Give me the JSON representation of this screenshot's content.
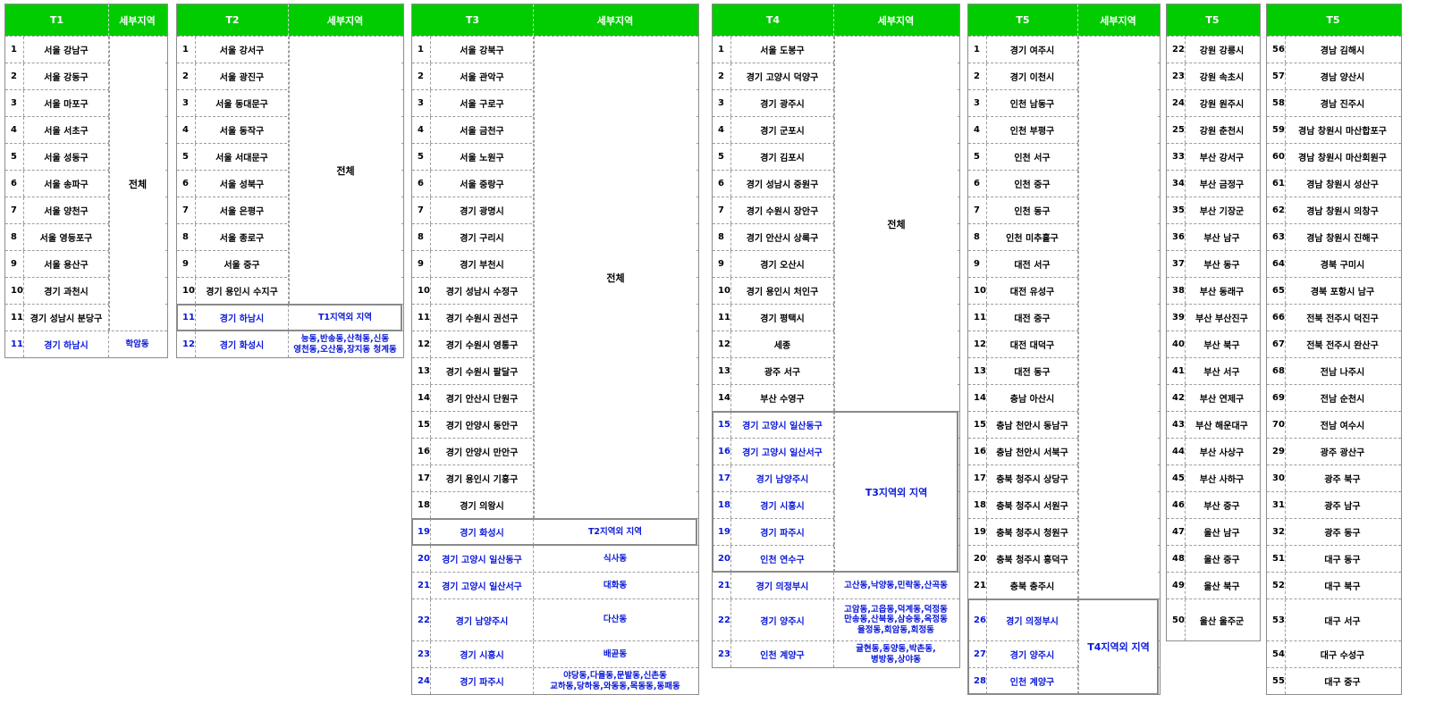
{
  "t1": {
    "header": [
      "T1",
      "세부지역"
    ],
    "rows": [
      {
        "n": "1",
        "r": "서울 강남구"
      },
      {
        "n": "2",
        "r": "서울 강동구"
      },
      {
        "n": "3",
        "r": "서울 마포구"
      },
      {
        "n": "4",
        "r": "서울 서초구"
      },
      {
        "n": "5",
        "r": "서울 성동구"
      },
      {
        "n": "6",
        "r": "서울 송파구"
      },
      {
        "n": "7",
        "r": "서울 양천구"
      },
      {
        "n": "8",
        "r": "서울 영등포구"
      },
      {
        "n": "9",
        "r": "서울 용산구"
      },
      {
        "n": "10",
        "r": "경기 과천시"
      },
      {
        "n": "11",
        "r": "경기 성남시 분당구"
      },
      {
        "n": "11",
        "r": "경기 하남시",
        "s": "학암동",
        "blue": true
      }
    ],
    "merged": "전체"
  },
  "t2": {
    "header": [
      "T2",
      "세부지역"
    ],
    "rows": [
      {
        "n": "1",
        "r": "서울 강서구"
      },
      {
        "n": "2",
        "r": "서울 광진구"
      },
      {
        "n": "3",
        "r": "서울 동대문구"
      },
      {
        "n": "4",
        "r": "서울 동작구"
      },
      {
        "n": "5",
        "r": "서울 서대문구"
      },
      {
        "n": "6",
        "r": "서울 성북구"
      },
      {
        "n": "7",
        "r": "서울 은평구"
      },
      {
        "n": "8",
        "r": "서울 종로구"
      },
      {
        "n": "9",
        "r": "서울 중구"
      },
      {
        "n": "10",
        "r": "경기 용인시 수지구"
      },
      {
        "n": "11",
        "r": "경기 하남시",
        "s": "T1지역외 지역",
        "blue": true
      },
      {
        "n": "12",
        "r": "경기 화성시",
        "s": "능동,반송동,산척동,신동\n영천동,오산동,장지동 청계동",
        "blue": true
      }
    ],
    "merged": "전체"
  },
  "t3": {
    "header": [
      "T3",
      "세부지역"
    ],
    "rows": [
      {
        "n": "1",
        "r": "서울 강북구"
      },
      {
        "n": "2",
        "r": "서울 관악구"
      },
      {
        "n": "3",
        "r": "서울 구로구"
      },
      {
        "n": "4",
        "r": "서울 금천구"
      },
      {
        "n": "5",
        "r": "서울 노원구"
      },
      {
        "n": "6",
        "r": "서울 중랑구"
      },
      {
        "n": "7",
        "r": "경기 광명시"
      },
      {
        "n": "8",
        "r": "경기 구리시"
      },
      {
        "n": "9",
        "r": "경기 부천시"
      },
      {
        "n": "10",
        "r": "경기 성남시 수정구"
      },
      {
        "n": "11",
        "r": "경기 수원시 권선구"
      },
      {
        "n": "12",
        "r": "경기 수원시 영통구"
      },
      {
        "n": "13",
        "r": "경기 수원시 팔달구"
      },
      {
        "n": "14",
        "r": "경기 안산시 단원구"
      },
      {
        "n": "15",
        "r": "경기 안양시 동안구"
      },
      {
        "n": "16",
        "r": "경기 안양시 만안구"
      },
      {
        "n": "17",
        "r": "경기 용인시 기흥구"
      },
      {
        "n": "18",
        "r": "경기 의왕시"
      },
      {
        "n": "19",
        "r": "경기 화성시",
        "s": "T2지역외 지역",
        "blue": true
      },
      {
        "n": "20",
        "r": "경기 고양시 일산동구",
        "s": "식사동",
        "blue": true
      },
      {
        "n": "21",
        "r": "경기 고양시 일산서구",
        "s": "대화동",
        "blue": true
      },
      {
        "n": "22",
        "r": "경기 남양주시",
        "s": "다산동",
        "blue": true
      },
      {
        "n": "23",
        "r": "경기 시흥시",
        "s": "배곧동",
        "blue": true
      },
      {
        "n": "24",
        "r": "경기 파주시",
        "s": "야당동,다율동,문발동,신촌동\n교하동,당하동,와동동,목동동,동패동",
        "blue": true
      }
    ],
    "merged": "전체"
  },
  "t4": {
    "header": [
      "T4",
      "세부지역"
    ],
    "rows": [
      {
        "n": "1",
        "r": "서울 도봉구"
      },
      {
        "n": "2",
        "r": "경기 고양시 덕양구"
      },
      {
        "n": "3",
        "r": "경기 광주시"
      },
      {
        "n": "4",
        "r": "경기 군포시"
      },
      {
        "n": "5",
        "r": "경기 김포시"
      },
      {
        "n": "6",
        "r": "경기 성남시 중원구"
      },
      {
        "n": "7",
        "r": "경기 수원시 장안구"
      },
      {
        "n": "8",
        "r": "경기 안산시 상록구"
      },
      {
        "n": "9",
        "r": "경기 오산시"
      },
      {
        "n": "10",
        "r": "경기 용인시 처인구"
      },
      {
        "n": "11",
        "r": "경기 평택시"
      },
      {
        "n": "12",
        "r": "세종"
      },
      {
        "n": "13",
        "r": "광주 서구"
      },
      {
        "n": "14",
        "r": "부산 수영구"
      },
      {
        "n": "15",
        "r": "경기 고양시 일산동구",
        "blue": true
      },
      {
        "n": "16",
        "r": "경기 고양시 일산서구",
        "blue": true
      },
      {
        "n": "17",
        "r": "경기 남양주시",
        "blue": true
      },
      {
        "n": "18",
        "r": "경기 시흥시",
        "blue": true
      },
      {
        "n": "19",
        "r": "경기 파주시",
        "blue": true
      },
      {
        "n": "20",
        "r": "인천 연수구",
        "blue": true
      },
      {
        "n": "21",
        "r": "경기 의정부시",
        "s": "고산동,낙양동,민락동,산곡동",
        "blue": true
      },
      {
        "n": "22",
        "r": "경기 양주시",
        "s": "고암동,고읍동,덕계동,덕정동\n만송동,산북동,삼숭동,옥정동\n율정동,회암동,회정동",
        "blue": true
      },
      {
        "n": "23",
        "r": "인천 계양구",
        "s": "귤현동,동양동,박촌동,\n병방동,상야동",
        "blue": true
      }
    ],
    "merged": "전체",
    "merged2": "T3지역외 지역"
  },
  "t5": {
    "header": [
      "T5",
      "세부지역"
    ],
    "rows": [
      {
        "n": "1",
        "r": "경기 여주시"
      },
      {
        "n": "2",
        "r": "경기 이천시"
      },
      {
        "n": "3",
        "r": "인천 남동구"
      },
      {
        "n": "4",
        "r": "인천 부평구"
      },
      {
        "n": "5",
        "r": "인천 서구"
      },
      {
        "n": "6",
        "r": "인천 중구"
      },
      {
        "n": "7",
        "r": "인천 동구"
      },
      {
        "n": "8",
        "r": "인천 미추홀구"
      },
      {
        "n": "9",
        "r": "대전 서구"
      },
      {
        "n": "10",
        "r": "대전 유성구"
      },
      {
        "n": "11",
        "r": "대전 중구"
      },
      {
        "n": "12",
        "r": "대전 대덕구"
      },
      {
        "n": "13",
        "r": "대전 동구"
      },
      {
        "n": "14",
        "r": "충남 아산시"
      },
      {
        "n": "15",
        "r": "충남 천안시 동남구"
      },
      {
        "n": "16",
        "r": "충남 천안시 서북구"
      },
      {
        "n": "17",
        "r": "충북 청주시 상당구"
      },
      {
        "n": "18",
        "r": "충북 청주시 서원구"
      },
      {
        "n": "19",
        "r": "충북 청주시 청원구"
      },
      {
        "n": "20",
        "r": "충북 청주시 흥덕구"
      },
      {
        "n": "21",
        "r": "충북 충주시"
      },
      {
        "n": "26",
        "r": "경기 의정부시",
        "blue": true
      },
      {
        "n": "27",
        "r": "경기 양주시",
        "blue": true
      },
      {
        "n": "28",
        "r": "인천 계양구",
        "blue": true
      }
    ],
    "merged2": "T4지역외 지역"
  },
  "t6": {
    "header": [
      "T5"
    ],
    "rows": [
      {
        "n": "22",
        "r": "강원 강릉시"
      },
      {
        "n": "23",
        "r": "강원 속초시"
      },
      {
        "n": "24",
        "r": "강원 원주시"
      },
      {
        "n": "25",
        "r": "강원 춘천시"
      },
      {
        "n": "33",
        "r": "부산 강서구"
      },
      {
        "n": "34",
        "r": "부산 금정구"
      },
      {
        "n": "35",
        "r": "부산 기장군"
      },
      {
        "n": "36",
        "r": "부산 남구"
      },
      {
        "n": "37",
        "r": "부산 동구"
      },
      {
        "n": "38",
        "r": "부산 동래구"
      },
      {
        "n": "39",
        "r": "부산 부산진구"
      },
      {
        "n": "40",
        "r": "부산 북구"
      },
      {
        "n": "41",
        "r": "부산 서구"
      },
      {
        "n": "42",
        "r": "부산 연제구"
      },
      {
        "n": "43",
        "r": "부산 해운대구"
      },
      {
        "n": "44",
        "r": "부산 사상구"
      },
      {
        "n": "45",
        "r": "부산 사하구"
      },
      {
        "n": "46",
        "r": "부산 중구"
      },
      {
        "n": "47",
        "r": "울산 남구"
      },
      {
        "n": "48",
        "r": "울산 중구"
      },
      {
        "n": "49",
        "r": "울산 북구"
      },
      {
        "n": "50",
        "r": "울산 울주군"
      }
    ]
  },
  "t7": {
    "header": [
      "T5"
    ],
    "rows": [
      {
        "n": "56",
        "r": "경남 김해시"
      },
      {
        "n": "57",
        "r": "경남 양산시"
      },
      {
        "n": "58",
        "r": "경남 진주시"
      },
      {
        "n": "59",
        "r": "경남 창원시 마산합포구"
      },
      {
        "n": "60",
        "r": "경남 창원시 마산회원구"
      },
      {
        "n": "61",
        "r": "경남 창원시 성산구"
      },
      {
        "n": "62",
        "r": "경남 창원시 의창구"
      },
      {
        "n": "63",
        "r": "경남 창원시 진해구"
      },
      {
        "n": "64",
        "r": "경북 구미시"
      },
      {
        "n": "65",
        "r": "경북 포항시 남구"
      },
      {
        "n": "66",
        "r": "전북 전주시 덕진구"
      },
      {
        "n": "67",
        "r": "전북 전주시 완산구"
      },
      {
        "n": "68",
        "r": "전남 나주시"
      },
      {
        "n": "69",
        "r": "전남 순천시"
      },
      {
        "n": "70",
        "r": "전남 여수시"
      },
      {
        "n": "29",
        "r": "광주 광산구"
      },
      {
        "n": "30",
        "r": "광주 북구"
      },
      {
        "n": "31",
        "r": "광주 남구"
      },
      {
        "n": "32",
        "r": "광주 동구"
      },
      {
        "n": "51",
        "r": "대구 동구"
      },
      {
        "n": "52",
        "r": "대구 북구"
      },
      {
        "n": "53",
        "r": "대구 서구"
      },
      {
        "n": "54",
        "r": "대구 수성구"
      },
      {
        "n": "55",
        "r": "대구 중구"
      }
    ]
  }
}
